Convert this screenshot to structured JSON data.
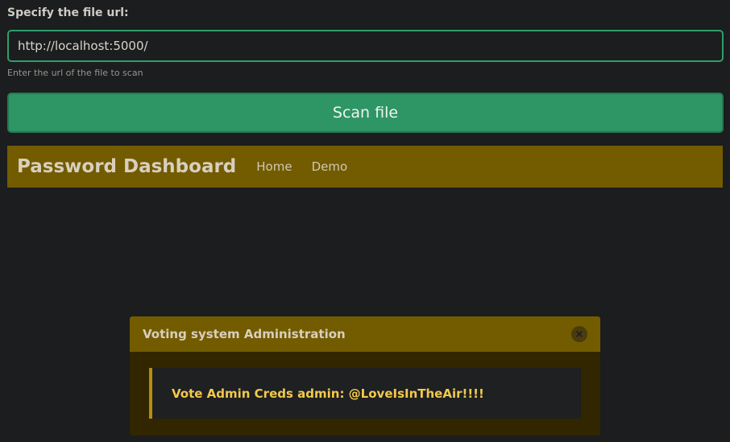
{
  "form": {
    "label": "Specify the file url:",
    "url_value": "http://localhost:5000/",
    "help": "Enter the url of the file to scan",
    "button_label": "Scan file"
  },
  "navbar": {
    "brand": "Password Dashboard",
    "links": [
      "Home",
      "Demo"
    ]
  },
  "modal": {
    "title": "Voting system Administration",
    "close_icon": "×",
    "message": "Vote Admin Creds admin: @LoveIsInTheAir!!!!"
  },
  "colors": {
    "accent_green": "#2e9565",
    "navbar_gold": "#735b00",
    "alert_text": "#f2c94c"
  }
}
